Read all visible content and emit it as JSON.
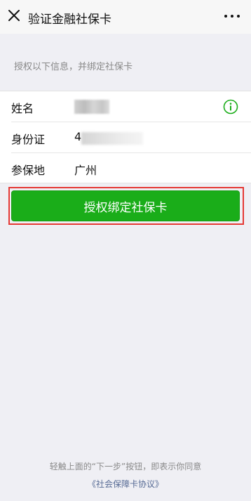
{
  "nav": {
    "title": "验证金融社保卡"
  },
  "hint": "授权以下信息，并绑定社保卡",
  "fields": [
    {
      "label": "姓名",
      "value": ""
    },
    {
      "label": "身份证",
      "value": "4"
    },
    {
      "label": "参保地",
      "value": "广州"
    }
  ],
  "button": {
    "label": "授权绑定社保卡"
  },
  "footer": {
    "notice": "轻触上面的“下一步”按钮，即表示你同意",
    "agreement_link": "《社会保障卡协议》"
  },
  "colors": {
    "primary_green": "#1aad19",
    "highlight_red": "#e53935",
    "link_blue": "#576b95"
  },
  "icons": [
    "close-icon",
    "more-icon",
    "info-icon"
  ]
}
